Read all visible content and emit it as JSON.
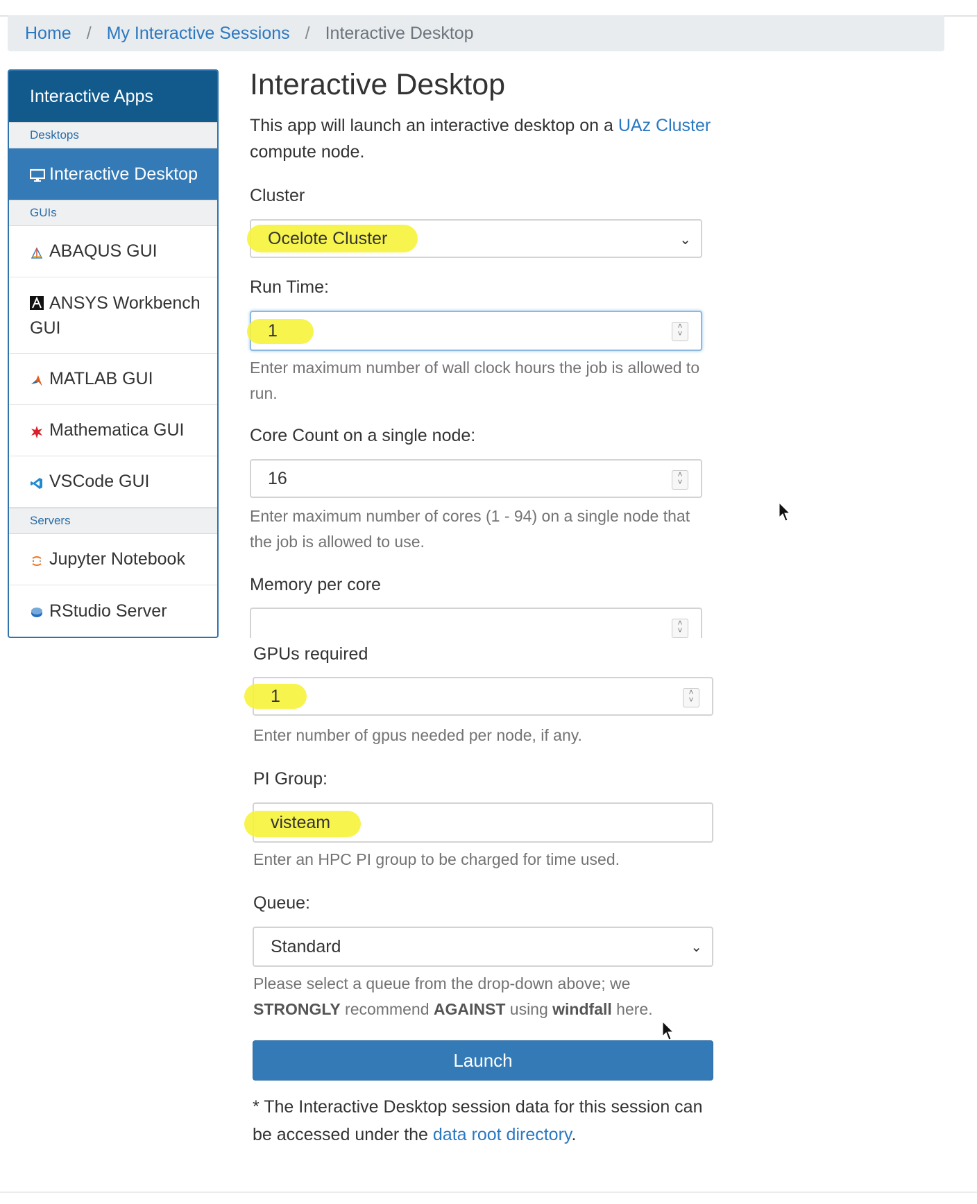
{
  "breadcrumb": {
    "home": "Home",
    "sessions": "My Interactive Sessions",
    "current": "Interactive Desktop",
    "sep": "/"
  },
  "sidebar": {
    "header": "Interactive Apps",
    "groups": {
      "desktops": "Desktops",
      "guis": "GUIs",
      "servers": "Servers"
    },
    "items": {
      "interactive_desktop": "Interactive Desktop",
      "abaqus": "ABAQUS GUI",
      "ansys": "ANSYS Workbench GUI",
      "matlab": "MATLAB GUI",
      "mathematica": "Mathematica GUI",
      "vscode": "VSCode GUI",
      "jupyter": "Jupyter Notebook",
      "rstudio": "RStudio Server"
    }
  },
  "main": {
    "title": "Interactive Desktop",
    "desc_before": "This app will launch an interactive desktop on a ",
    "desc_link": "UAz Cluster",
    "desc_after": " compute node.",
    "cluster": {
      "label": "Cluster",
      "value": "Ocelote Cluster"
    },
    "runtime": {
      "label": "Run Time:",
      "value": "1",
      "help": "Enter maximum number of wall clock hours the job is allowed to run."
    },
    "cores": {
      "label": "Core Count on a single node:",
      "value": "16",
      "help": "Enter maximum number of cores (1 - 94) on a single node that the job is allowed to use."
    },
    "memory": {
      "label": "Memory per core",
      "value": ""
    },
    "gpus": {
      "label": "GPUs required",
      "value": "1",
      "help": "Enter number of gpus needed per node, if any."
    },
    "pigroup": {
      "label": "PI Group:",
      "value": "visteam",
      "help": "Enter an HPC PI group to be charged for time used."
    },
    "queue": {
      "label": "Queue:",
      "value": "Standard",
      "help_1": "Please select a queue from the drop-down above; we",
      "help_strongly": "STRONGLY",
      "help_2": " recommend ",
      "help_against": "AGAINST",
      "help_3": " using ",
      "help_windfall": "windfall",
      "help_4": " here."
    },
    "launch": "Launch",
    "footnote_before": "* The Interactive Desktop session data for this session can be accessed under the ",
    "footnote_link": "data root directory",
    "footnote_after": "."
  },
  "colors": {
    "primary": "#337ab7",
    "sidebar_header": "#125a8c",
    "link": "#2a78c1",
    "highlight": "#f6f33a"
  }
}
